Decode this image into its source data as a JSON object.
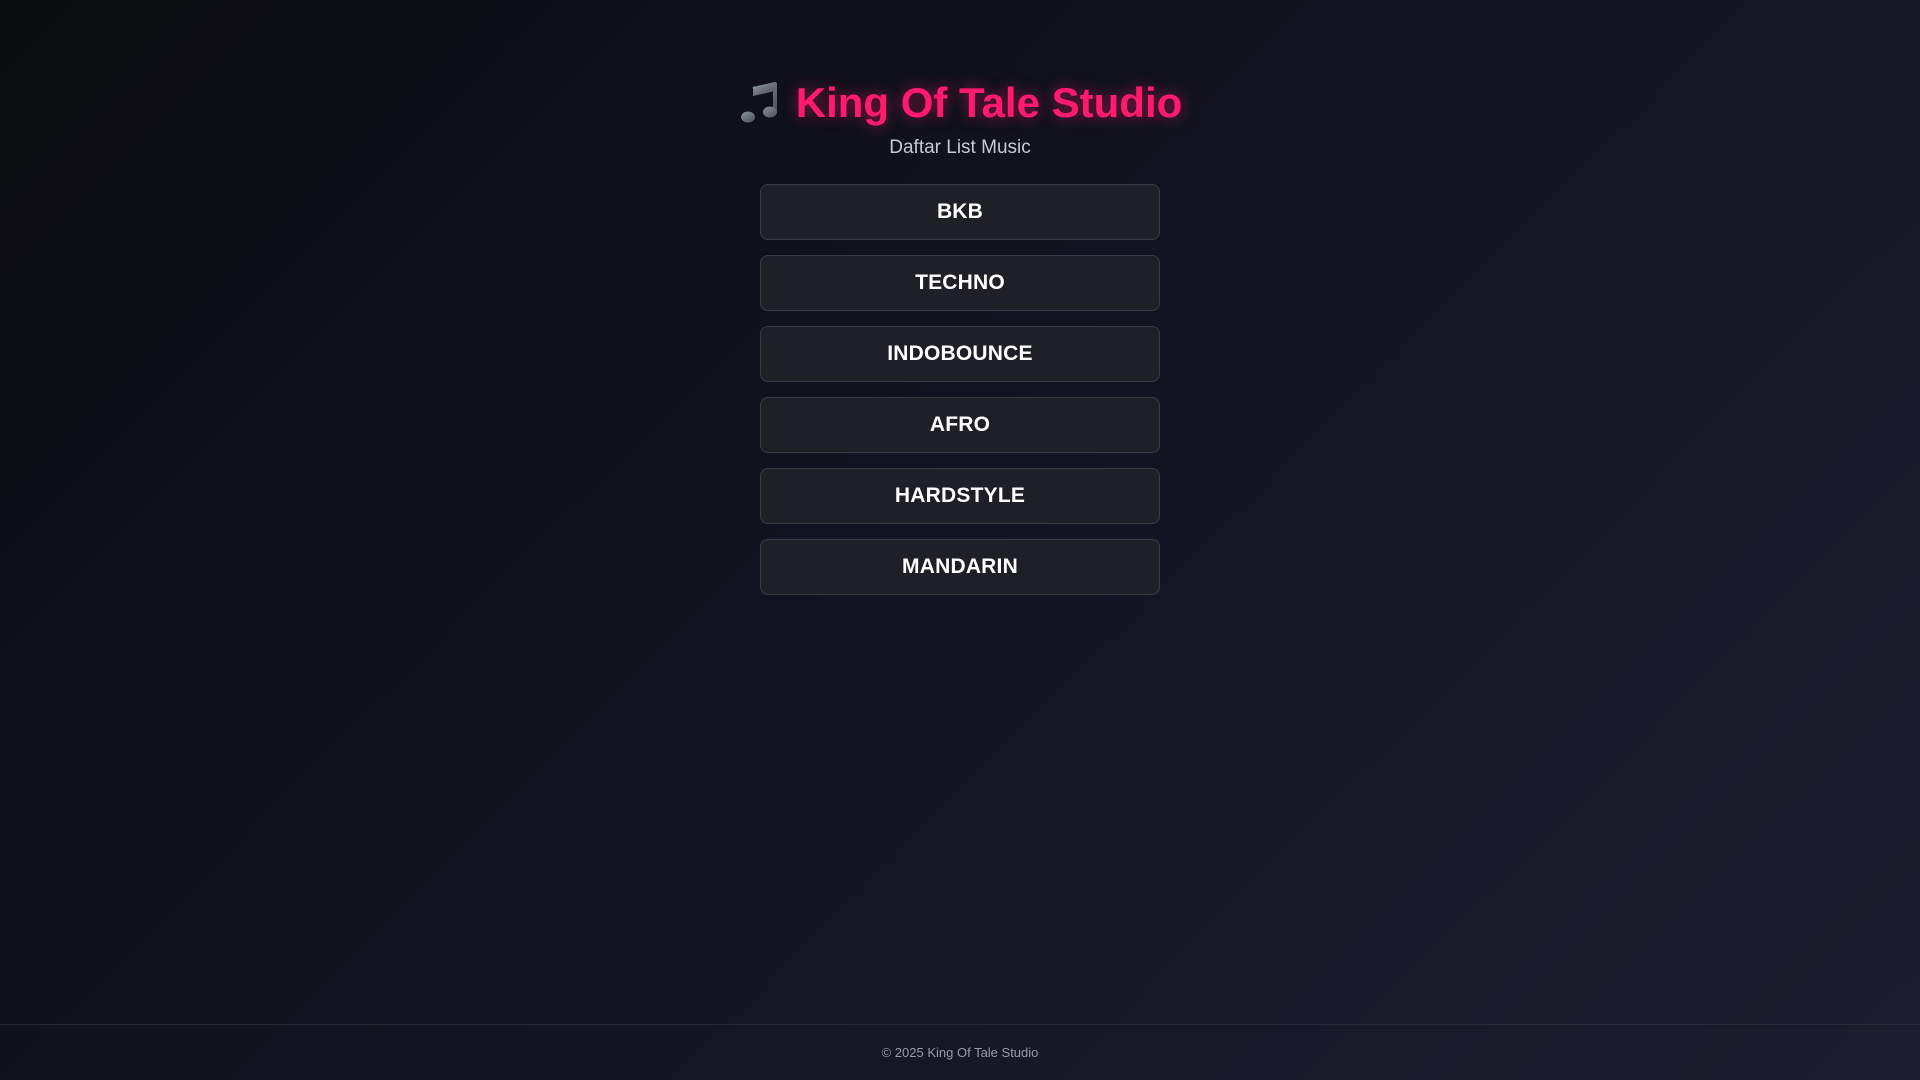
{
  "header": {
    "icon": "musical-note-icon",
    "title": "King Of Tale Studio",
    "subtitle": "Daftar List Music"
  },
  "menu": {
    "items": [
      {
        "label": "BKB"
      },
      {
        "label": "TECHNO"
      },
      {
        "label": "INDOBOUNCE"
      },
      {
        "label": "AFRO"
      },
      {
        "label": "HARDSTYLE"
      },
      {
        "label": "MANDARIN"
      }
    ]
  },
  "footer": {
    "text": "© 2025 King Of Tale Studio"
  },
  "colors": {
    "accent": "#ff1a6e",
    "button_bg": "#1f1f28",
    "button_border": "#3b3b47",
    "background": "#121320"
  }
}
